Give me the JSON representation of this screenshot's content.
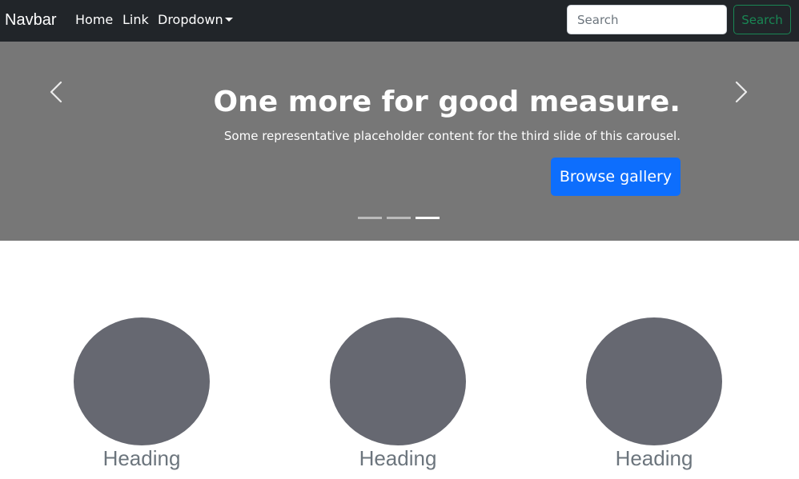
{
  "navbar": {
    "brand": "Navbar",
    "links": [
      "Home",
      "Link",
      "Dropdown"
    ],
    "search": {
      "placeholder": "Search",
      "button_label": "Search"
    },
    "background_color": "#212529"
  },
  "carousel": {
    "slide_title": "One more for good measure.",
    "slide_text": "Some representative placeholder content for the third slide of this carousel.",
    "button_label": "Browse gallery",
    "active_indicator": 3,
    "indicator_count": 3,
    "background_color": "#777777",
    "button_color": "#0d6efd"
  },
  "marketing": {
    "columns": [
      {
        "heading": "Heading"
      },
      {
        "heading": "Heading"
      },
      {
        "heading": "Heading"
      }
    ],
    "placeholder_color": "#666871"
  }
}
